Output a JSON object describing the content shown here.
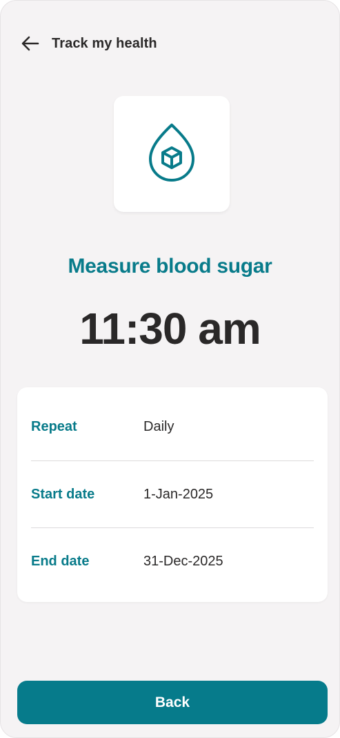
{
  "header": {
    "title": "Track my health",
    "back_icon": "arrow-left-icon"
  },
  "task": {
    "icon": "blood-drop-icon",
    "title": "Measure blood sugar",
    "time": "11:30 am"
  },
  "details": [
    {
      "label": "Repeat",
      "value": "Daily"
    },
    {
      "label": "Start date",
      "value": "1-Jan-2025"
    },
    {
      "label": "End date",
      "value": "31-Dec-2025"
    }
  ],
  "footer": {
    "back_label": "Back"
  },
  "colors": {
    "accent": "#087b8a",
    "button": "#067b8b",
    "text": "#2a2828",
    "background": "#f5f3f4"
  }
}
